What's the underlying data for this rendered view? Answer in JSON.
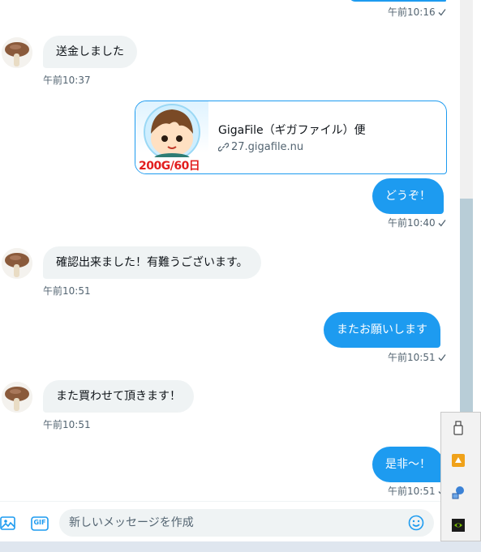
{
  "messages": [
    {
      "id": "m0",
      "direction": "out",
      "time": "午前10:16"
    },
    {
      "id": "m1",
      "direction": "in",
      "text": "送金しました",
      "time": "午前10:37"
    },
    {
      "id": "m2",
      "direction": "out",
      "type": "link_card",
      "card": {
        "title": "GigaFile（ギガファイル）便",
        "url": "27.gigafile.nu",
        "thumb_text": "200G/60日"
      }
    },
    {
      "id": "m3",
      "direction": "out",
      "text": "どうぞ！",
      "time": "午前10:40"
    },
    {
      "id": "m4",
      "direction": "in",
      "text": "確認出来ました！有難うございます。",
      "time": "午前10:51"
    },
    {
      "id": "m5",
      "direction": "out",
      "text": "またお願いします",
      "time": "午前10:51"
    },
    {
      "id": "m6",
      "direction": "in",
      "text": "また買わせて頂きます！",
      "time": "午前10:51"
    },
    {
      "id": "m7",
      "direction": "out",
      "text": "是非〜！",
      "time": "午前10:51"
    }
  ],
  "composer": {
    "placeholder": "新しいメッセージを作成",
    "gif_label": "GIF",
    "icons": [
      "image-icon",
      "gif-icon",
      "emoji-icon"
    ]
  },
  "tray": {
    "icons": [
      "usb-drive-icon",
      "app-update-icon",
      "network-icon",
      "nvidia-icon"
    ]
  },
  "colors": {
    "accent": "#1d9bf0",
    "incoming_bubble": "#eff3f4",
    "muted_text": "#536471",
    "scroll_thumb": "#b8cdd7"
  }
}
